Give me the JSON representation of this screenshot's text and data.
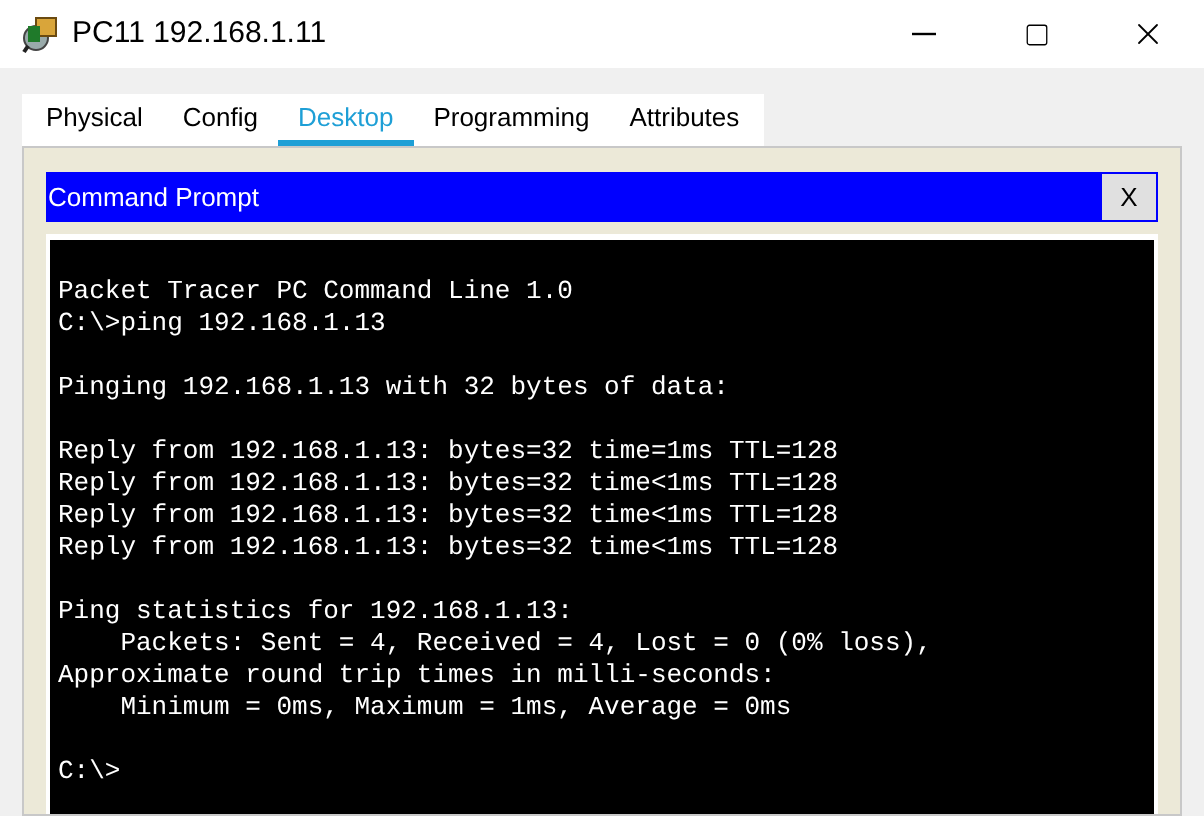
{
  "window": {
    "title": "PC11 192.168.1.11"
  },
  "tabs": [
    {
      "label": "Physical",
      "selected": false
    },
    {
      "label": "Config",
      "selected": false
    },
    {
      "label": "Desktop",
      "selected": true
    },
    {
      "label": "Programming",
      "selected": false
    },
    {
      "label": "Attributes",
      "selected": false
    }
  ],
  "command_prompt": {
    "title": "Command Prompt",
    "close_label": "X",
    "blocks": [
      {
        "lines": [
          "Packet Tracer PC Command Line 1.0",
          "C:\\>ping 192.168.1.13"
        ]
      },
      {
        "lines": [
          "Pinging 192.168.1.13 with 32 bytes of data:"
        ]
      },
      {
        "lines": [
          "Reply from 192.168.1.13: bytes=32 time=1ms TTL=128",
          "Reply from 192.168.1.13: bytes=32 time<1ms TTL=128",
          "Reply from 192.168.1.13: bytes=32 time<1ms TTL=128",
          "Reply from 192.168.1.13: bytes=32 time<1ms TTL=128"
        ]
      },
      {
        "lines": [
          "Ping statistics for 192.168.1.13:",
          "    Packets: Sent = 4, Received = 4, Lost = 0 (0% loss),",
          "Approximate round trip times in milli-seconds:",
          "    Minimum = 0ms, Maximum = 1ms, Average = 0ms"
        ]
      },
      {
        "lines": [
          "C:\\>"
        ]
      }
    ]
  }
}
